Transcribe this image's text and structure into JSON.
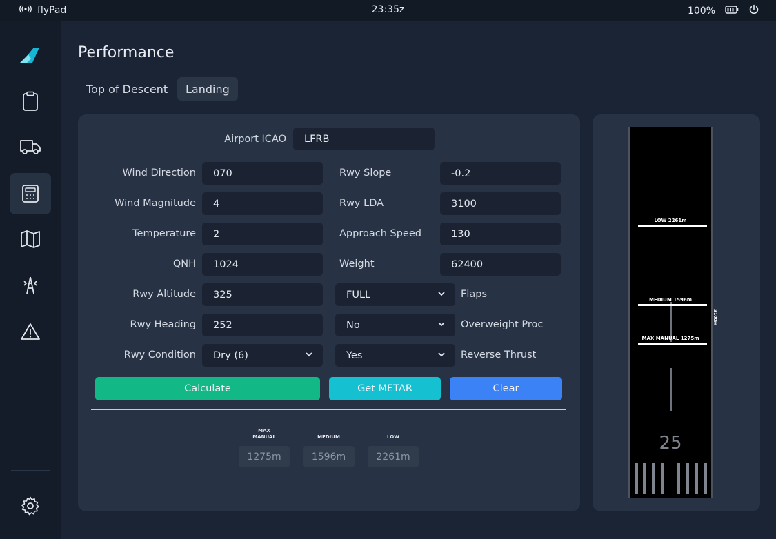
{
  "statusbar": {
    "app_name": "flyPad",
    "time": "23:35z",
    "battery": "100%"
  },
  "page": {
    "title": "Performance"
  },
  "tabs": [
    {
      "label": "Top of Descent"
    },
    {
      "label": "Landing"
    }
  ],
  "form": {
    "airport_icao": {
      "label": "Airport ICAO",
      "value": "LFRB"
    },
    "wind_direction": {
      "label": "Wind Direction",
      "value": "070"
    },
    "wind_magnitude": {
      "label": "Wind Magnitude",
      "value": "4"
    },
    "temperature": {
      "label": "Temperature",
      "value": "2"
    },
    "qnh": {
      "label": "QNH",
      "value": "1024"
    },
    "rwy_altitude": {
      "label": "Rwy Altitude",
      "value": "325"
    },
    "rwy_heading": {
      "label": "Rwy Heading",
      "value": "252"
    },
    "rwy_condition": {
      "label": "Rwy Condition",
      "value": "Dry (6)"
    },
    "rwy_slope": {
      "label": "Rwy Slope",
      "value": "-0.2"
    },
    "rwy_lda": {
      "label": "Rwy LDA",
      "value": "3100"
    },
    "approach_speed": {
      "label": "Approach Speed",
      "value": "130"
    },
    "weight": {
      "label": "Weight",
      "value": "62400"
    },
    "flaps": {
      "label": "Flaps",
      "value": "FULL"
    },
    "overweight_proc": {
      "label": "Overweight Proc",
      "value": "No"
    },
    "reverse_thrust": {
      "label": "Reverse Thrust",
      "value": "Yes"
    }
  },
  "buttons": {
    "calculate": "Calculate",
    "get_metar": "Get METAR",
    "clear": "Clear"
  },
  "results": {
    "max_manual": {
      "title_line1": "MAX",
      "title_line2": "MANUAL",
      "value": "1275m"
    },
    "medium": {
      "title": "MEDIUM",
      "value": "1596m"
    },
    "low": {
      "title": "LOW",
      "value": "2261m"
    }
  },
  "runway_visual": {
    "low_label": "LOW 2261m",
    "medium_label": "MEDIUM 1596m",
    "max_manual_label": "MAX MANUAL 1275m",
    "runway_number": "25",
    "runway_length_label": "3100m"
  },
  "colors": {
    "calculate": "#12b886",
    "get_metar": "#15c0d0",
    "clear": "#3b82f6",
    "accent_logo": "#18b6d6"
  },
  "icons": [
    "wifi-icon",
    "battery-icon",
    "power-icon",
    "logo-icon",
    "clipboard-icon",
    "truck-icon",
    "calculator-icon",
    "map-icon",
    "tower-icon",
    "warning-icon",
    "gear-icon",
    "chevron-down-icon"
  ]
}
